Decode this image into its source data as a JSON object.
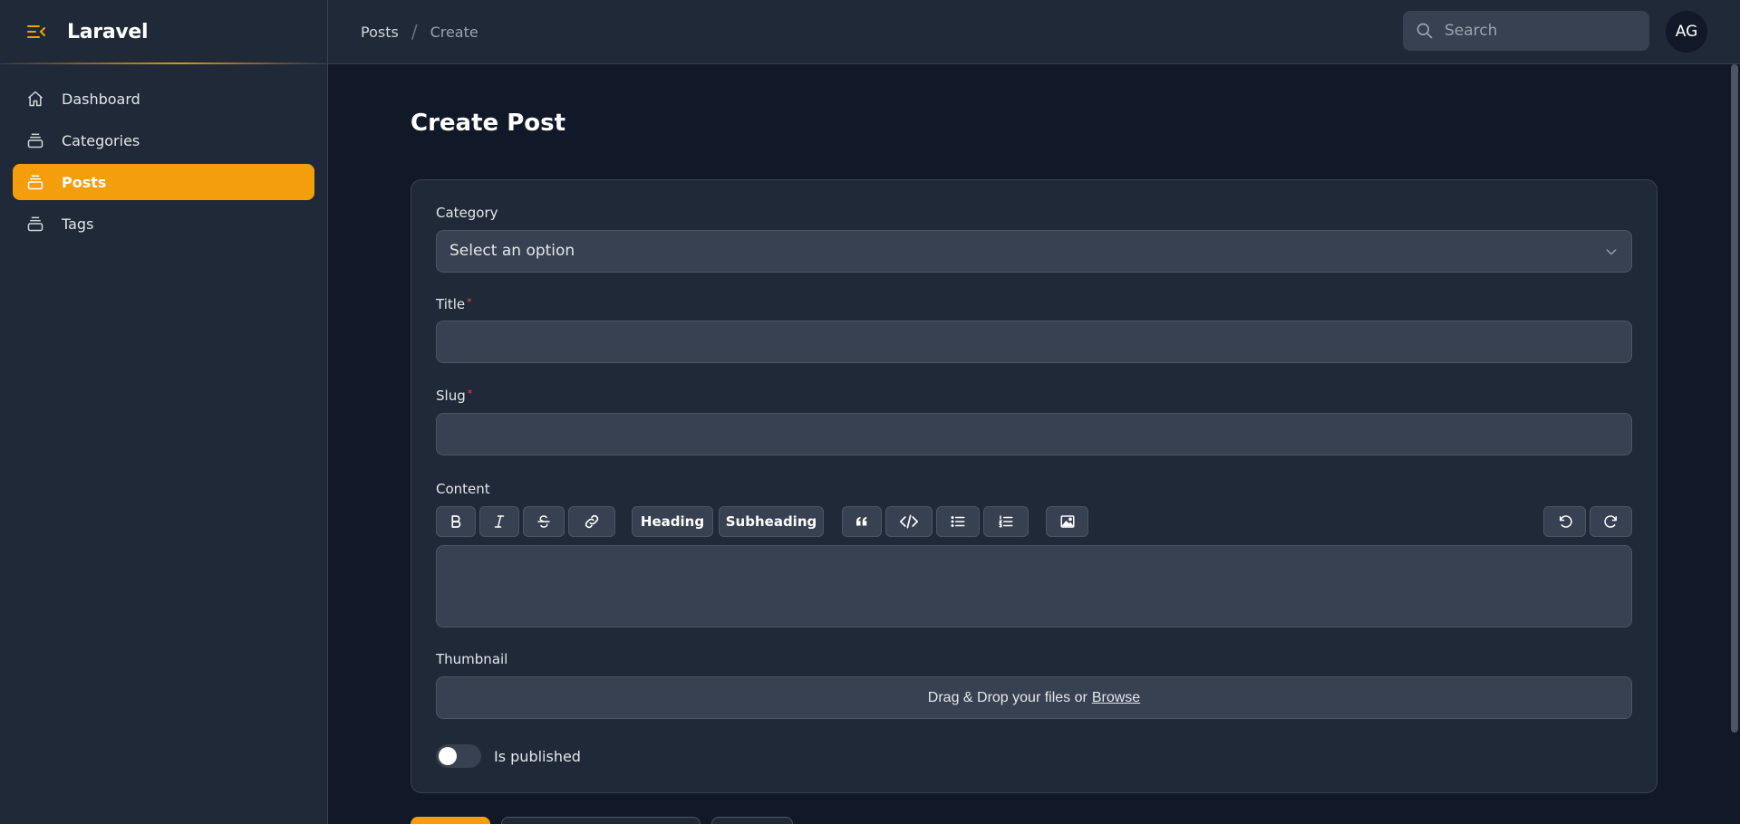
{
  "brand": {
    "name": "Laravel"
  },
  "sidebar": {
    "items": [
      {
        "label": "Dashboard",
        "icon": "home-icon",
        "active": false
      },
      {
        "label": "Categories",
        "icon": "stack-icon",
        "active": false
      },
      {
        "label": "Posts",
        "icon": "stack-icon",
        "active": true
      },
      {
        "label": "Tags",
        "icon": "stack-icon",
        "active": false
      }
    ]
  },
  "breadcrumb": {
    "parent": "Posts",
    "separator": "/",
    "current": "Create"
  },
  "search": {
    "placeholder": "Search"
  },
  "user": {
    "initials": "AG"
  },
  "page": {
    "title": "Create Post"
  },
  "form": {
    "category": {
      "label": "Category",
      "placeholder": "Select an option"
    },
    "title": {
      "label": "Title",
      "required_mark": "*",
      "value": ""
    },
    "slug": {
      "label": "Slug",
      "required_mark": "*",
      "value": ""
    },
    "content": {
      "label": "Content",
      "toolbar": {
        "heading": "Heading",
        "subheading": "Subheading"
      }
    },
    "thumbnail": {
      "label": "Thumbnail",
      "text": "Drag & Drop your files or",
      "browse": "Browse"
    },
    "published": {
      "label": "Is published",
      "checked": false
    }
  },
  "colors": {
    "accent": "#f59e0b",
    "background": "#111827",
    "panel": "#1f2937",
    "input": "#374151",
    "required": "#f43f5e"
  }
}
